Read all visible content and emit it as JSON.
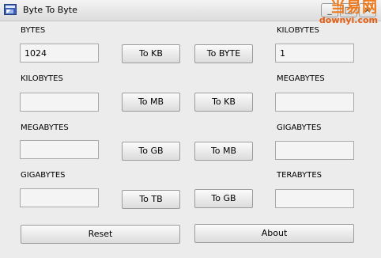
{
  "window": {
    "title": "Byte To Byte",
    "icon": "app-window-icon",
    "controls": {
      "minimize": "_",
      "maximize": "□",
      "close": "×"
    }
  },
  "watermark": {
    "main": "当易网",
    "sub": "downyi.com"
  },
  "rows": [
    {
      "left_label": "BYTES",
      "left_value": "1024",
      "btn_down": "To KB",
      "btn_up": "To BYTE",
      "right_label": "KILOBYTES",
      "right_value": "1"
    },
    {
      "left_label": "KILOBYTES",
      "left_value": "",
      "btn_down": "To MB",
      "btn_up": "To KB",
      "right_label": "MEGABYTES",
      "right_value": ""
    },
    {
      "left_label": "MEGABYTES",
      "left_value": "",
      "btn_down": "To GB",
      "btn_up": "To MB",
      "right_label": "GIGABYTES",
      "right_value": ""
    },
    {
      "left_label": "GIGABYTES",
      "left_value": "",
      "btn_down": "To TB",
      "btn_up": "To GB",
      "right_label": "TERABYTES",
      "right_value": ""
    }
  ],
  "footer": {
    "reset_label": "Reset",
    "about_label": "About"
  }
}
